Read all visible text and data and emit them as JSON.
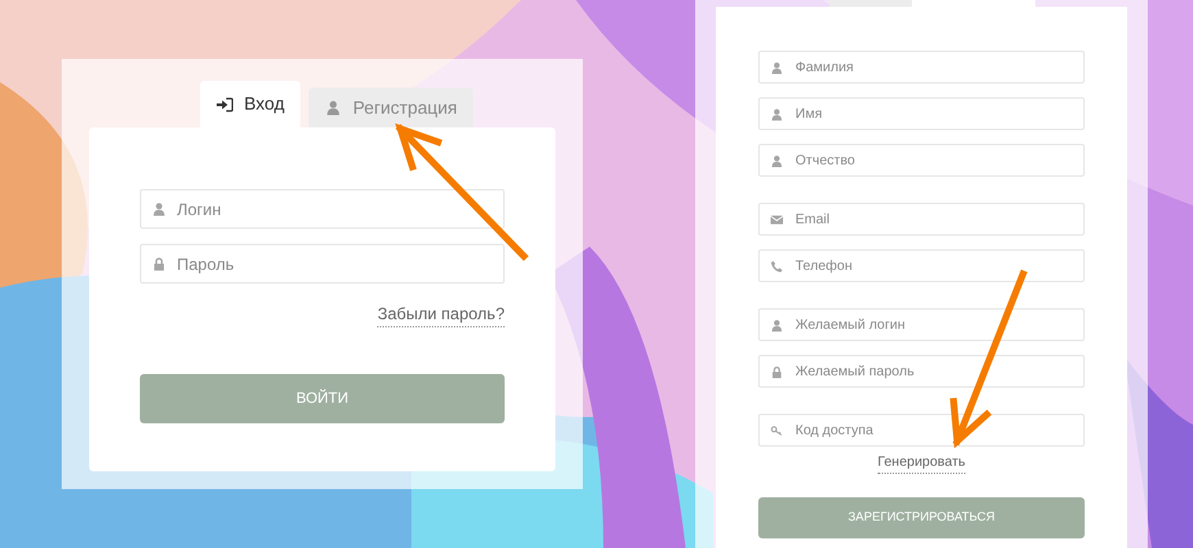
{
  "login_form": {
    "tabs": [
      {
        "label": "Вход",
        "kind": "sign-in",
        "selected": true
      },
      {
        "label": "Регистрация",
        "kind": "user",
        "selected": false
      }
    ],
    "fields": [
      {
        "placeholder": "Логин",
        "kind": "user"
      },
      {
        "placeholder": "Пароль",
        "kind": "lock"
      }
    ],
    "link": "Забыли пароль?",
    "button": "ВОЙТИ"
  },
  "register_form": {
    "tabs": [
      {
        "selected": false
      },
      {
        "selected": true
      }
    ],
    "field_groups": [
      [
        {
          "placeholder": "Фамилия",
          "kind": "user"
        },
        {
          "placeholder": "Имя",
          "kind": "user"
        },
        {
          "placeholder": "Отчество",
          "kind": "user"
        }
      ],
      [
        {
          "placeholder": "Email",
          "kind": "email"
        },
        {
          "placeholder": "Телефон",
          "kind": "phone"
        }
      ],
      [
        {
          "placeholder": "Желаемый логин",
          "kind": "user"
        },
        {
          "placeholder": "Желаемый пароль",
          "kind": "lock"
        }
      ],
      [
        {
          "placeholder": "Код доступа",
          "kind": "key"
        }
      ]
    ],
    "link": "Генерировать",
    "button": "ЗАРЕГИСТРИРОВАТЬСЯ"
  },
  "annotations": [
    {
      "kind": "arrow"
    },
    {
      "kind": "arrow"
    }
  ]
}
